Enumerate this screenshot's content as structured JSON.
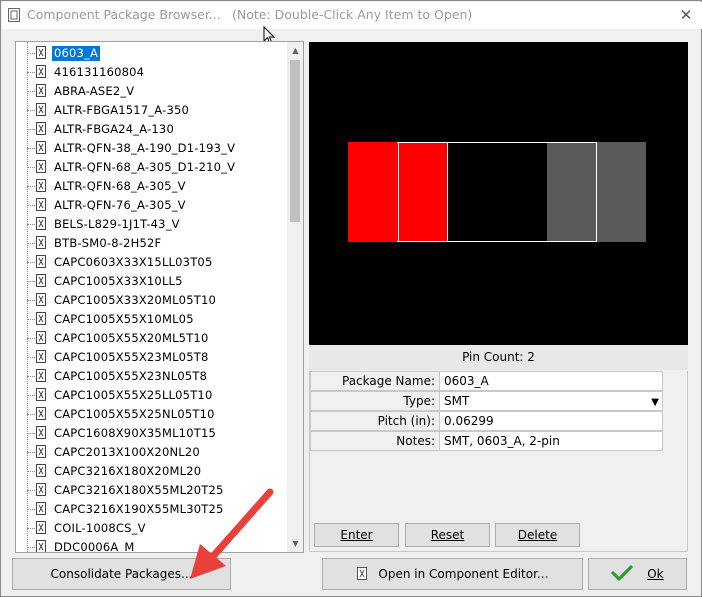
{
  "window": {
    "title": "Component Package Browser...",
    "note": "(Note: Double-Click Any Item to Open)",
    "close_glyph": "✕"
  },
  "tree": {
    "items": [
      {
        "label": "0603_A",
        "selected": true
      },
      {
        "label": "416131160804"
      },
      {
        "label": "ABRA-ASE2_V"
      },
      {
        "label": "ALTR-FBGA1517_A-350"
      },
      {
        "label": "ALTR-FBGA24_A-130"
      },
      {
        "label": "ALTR-QFN-38_A-190_D1-193_V"
      },
      {
        "label": "ALTR-QFN-68_A-305_D1-210_V"
      },
      {
        "label": "ALTR-QFN-68_A-305_V"
      },
      {
        "label": "ALTR-QFN-76_A-305_V"
      },
      {
        "label": "BELS-L829-1J1T-43_V"
      },
      {
        "label": "BTB-SM0-8-2H52F"
      },
      {
        "label": "CAPC0603X33X15LL03T05"
      },
      {
        "label": "CAPC1005X33X10LL5"
      },
      {
        "label": "CAPC1005X33X20ML05T10"
      },
      {
        "label": "CAPC1005X55X10ML05"
      },
      {
        "label": "CAPC1005X55X20ML5T10"
      },
      {
        "label": "CAPC1005X55X23ML05T8"
      },
      {
        "label": "CAPC1005X55X23NL05T8"
      },
      {
        "label": "CAPC1005X55X25LL05T10"
      },
      {
        "label": "CAPC1005X55X25NL05T10"
      },
      {
        "label": "CAPC1608X90X35ML10T15"
      },
      {
        "label": "CAPC2013X100X20NL20"
      },
      {
        "label": "CAPC3216X180X20ML20"
      },
      {
        "label": "CAPC3216X180X55ML20T25"
      },
      {
        "label": "CAPC3216X190X55ML30T25"
      },
      {
        "label": "COIL-1008CS_V"
      },
      {
        "label": "DDC0006A_M"
      }
    ]
  },
  "preview": {
    "pin_count_text": "Pin Count: 2",
    "colors": {
      "background": "#000000",
      "pad_selected": "#ff0000",
      "pad_other": "#5a5a5a",
      "outline": "#ffffff"
    }
  },
  "properties": [
    {
      "name": "Package Name:",
      "value": "0603_A"
    },
    {
      "name": "Type:",
      "value": "SMT",
      "dropdown": true
    },
    {
      "name": "Pitch (in):",
      "value": "0.06299"
    },
    {
      "name": "Notes:",
      "value": "SMT, 0603_A, 2-pin"
    }
  ],
  "buttons": {
    "enter": "Enter",
    "reset": "Reset",
    "delete": "Delete",
    "consolidate": "Consolidate Packages...",
    "open_editor": "Open in Component Editor...",
    "ok": "Ok"
  },
  "colors": {
    "accent": "#0078d7",
    "annotation_arrow": "#e8413b",
    "ok_check": "#2e9e2e"
  }
}
